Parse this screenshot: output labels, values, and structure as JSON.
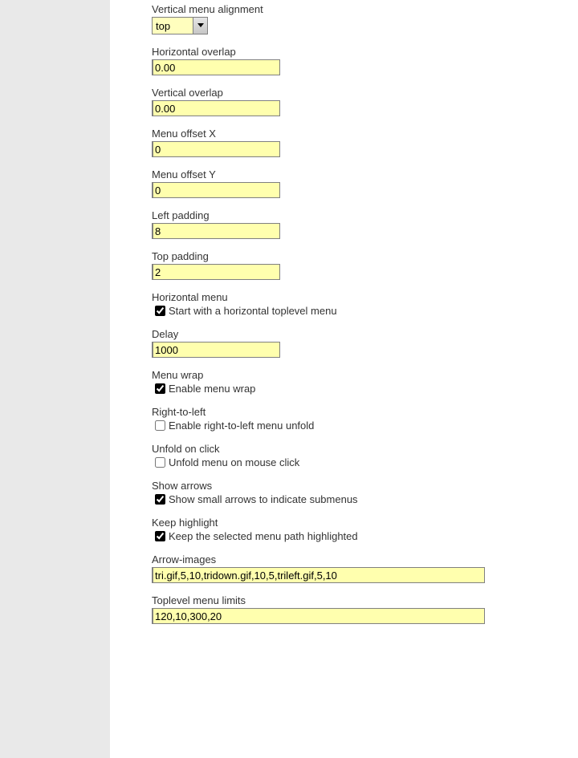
{
  "fields": {
    "vertical_menu_alignment": {
      "label": "Vertical menu alignment",
      "selected": "top"
    },
    "horizontal_overlap": {
      "label": "Horizontal overlap",
      "value": "0.00"
    },
    "vertical_overlap": {
      "label": "Vertical overlap",
      "value": "0.00"
    },
    "menu_offset_x": {
      "label": "Menu offset X",
      "value": "0"
    },
    "menu_offset_y": {
      "label": "Menu offset Y",
      "value": "0"
    },
    "left_padding": {
      "label": "Left padding",
      "value": "8"
    },
    "top_padding": {
      "label": "Top padding",
      "value": "2"
    },
    "horizontal_menu": {
      "label": "Horizontal menu",
      "checkbox_label": "Start with a horizontal toplevel menu",
      "checked": true
    },
    "delay": {
      "label": "Delay",
      "value": "1000"
    },
    "menu_wrap": {
      "label": "Menu wrap",
      "checkbox_label": "Enable menu wrap",
      "checked": true
    },
    "right_to_left": {
      "label": "Right-to-left",
      "checkbox_label": "Enable right-to-left menu unfold",
      "checked": false
    },
    "unfold_on_click": {
      "label": "Unfold on click",
      "checkbox_label": "Unfold menu on mouse click",
      "checked": false
    },
    "show_arrows": {
      "label": "Show arrows",
      "checkbox_label": "Show small arrows to indicate submenus",
      "checked": true
    },
    "keep_highlight": {
      "label": "Keep highlight",
      "checkbox_label": "Keep the selected menu path highlighted",
      "checked": true
    },
    "arrow_images": {
      "label": "Arrow-images",
      "value": "tri.gif,5,10,tridown.gif,10,5,trileft.gif,5,10"
    },
    "toplevel_menu_limits": {
      "label": "Toplevel menu limits",
      "value": "120,10,300,20"
    }
  }
}
